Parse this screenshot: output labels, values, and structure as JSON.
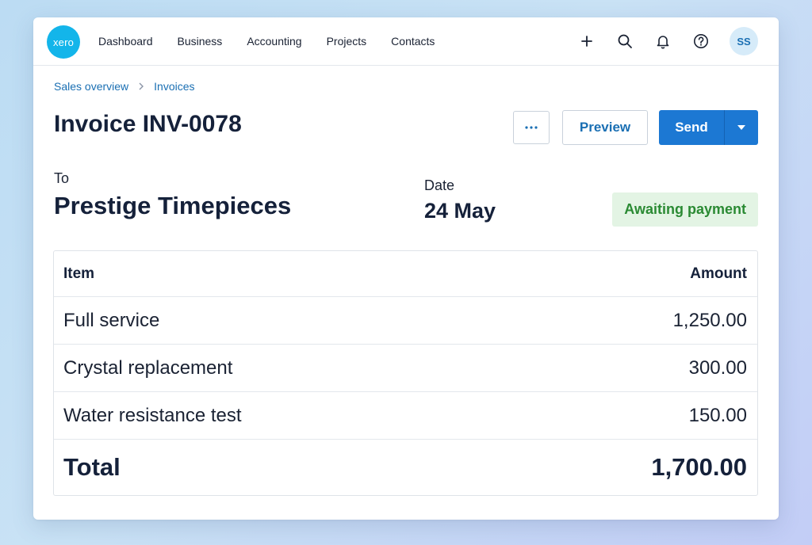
{
  "brand": {
    "logo_text": "xero",
    "color": "#13b5ea"
  },
  "nav": {
    "items": [
      {
        "label": "Dashboard"
      },
      {
        "label": "Business"
      },
      {
        "label": "Accounting"
      },
      {
        "label": "Projects"
      },
      {
        "label": "Contacts"
      }
    ]
  },
  "header_icons": [
    "add-icon",
    "search-icon",
    "bell-icon",
    "help-icon"
  ],
  "user": {
    "initials": "SS"
  },
  "breadcrumb": {
    "parent": "Sales overview",
    "current": "Invoices"
  },
  "page": {
    "title": "Invoice INV-0078"
  },
  "actions": {
    "more_label": "···",
    "preview_label": "Preview",
    "send_label": "Send",
    "accent": "#1c78d3"
  },
  "invoice": {
    "to_label": "To",
    "to_value": "Prestige Timepieces",
    "date_label": "Date",
    "date_value": "24 May",
    "status": "Awaiting payment",
    "status_color": "#2a8a33"
  },
  "table": {
    "headers": {
      "item": "Item",
      "amount": "Amount"
    },
    "rows": [
      {
        "item": "Full service",
        "amount": "1,250.00"
      },
      {
        "item": "Crystal replacement",
        "amount": "300.00"
      },
      {
        "item": "Water resistance test",
        "amount": "150.00"
      }
    ],
    "total": {
      "label": "Total",
      "amount": "1,700.00"
    }
  }
}
